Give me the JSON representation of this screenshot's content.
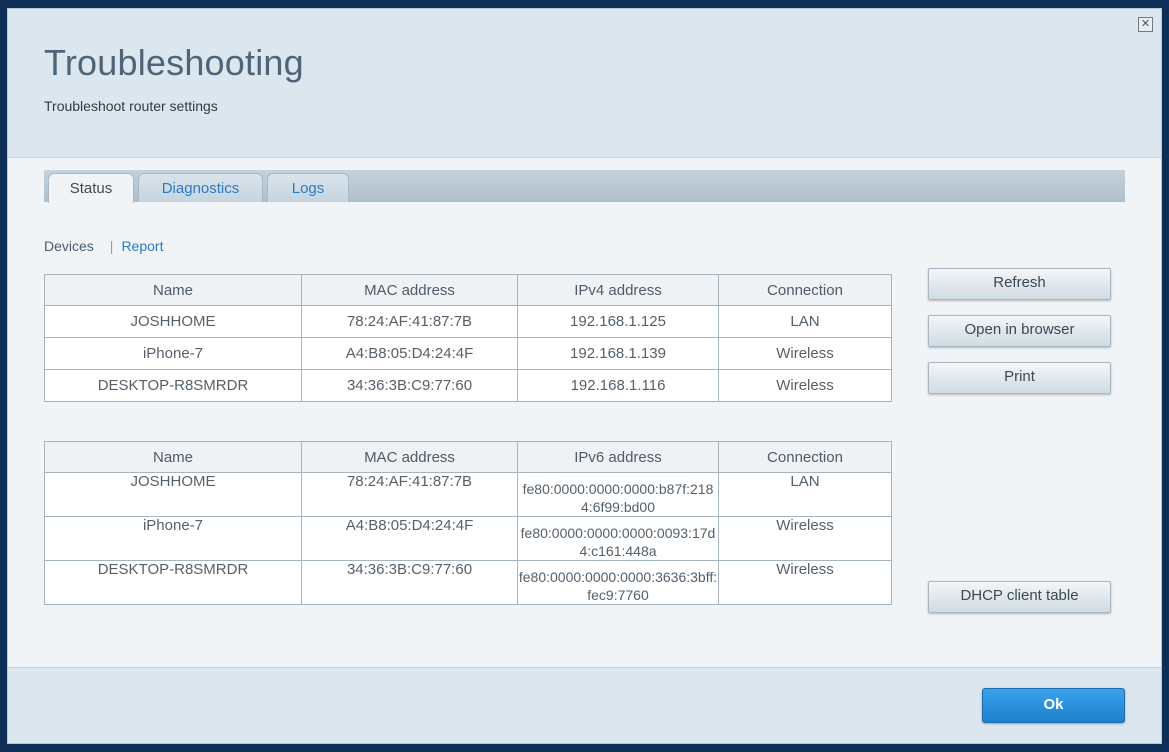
{
  "dialog": {
    "title": "Troubleshooting",
    "subtitle": "Troubleshoot router settings",
    "close_icon": "close-icon"
  },
  "tabs": [
    {
      "label": "Status",
      "active": true
    },
    {
      "label": "Diagnostics",
      "active": false
    },
    {
      "label": "Logs",
      "active": false
    }
  ],
  "subnav": {
    "devices": "Devices",
    "separator": "|",
    "report": "Report"
  },
  "ipv4_table": {
    "headers": [
      "Name",
      "MAC address",
      "IPv4 address",
      "Connection"
    ],
    "rows": [
      [
        "JOSHHOME",
        "78:24:AF:41:87:7B",
        "192.168.1.125",
        "LAN"
      ],
      [
        "iPhone-7",
        "A4:B8:05:D4:24:4F",
        "192.168.1.139",
        "Wireless"
      ],
      [
        "DESKTOP-R8SMRDR",
        "34:36:3B:C9:77:60",
        "192.168.1.116",
        "Wireless"
      ]
    ]
  },
  "ipv6_table": {
    "headers": [
      "Name",
      "MAC address",
      "IPv6 address",
      "Connection"
    ],
    "rows": [
      [
        "JOSHHOME",
        "78:24:AF:41:87:7B",
        "fe80:0000:0000:0000:b87f:2184:6f99:bd00",
        "LAN"
      ],
      [
        "iPhone-7",
        "A4:B8:05:D4:24:4F",
        "fe80:0000:0000:0000:0093:17d4:c161:448a",
        "Wireless"
      ],
      [
        "DESKTOP-R8SMRDR",
        "34:36:3B:C9:77:60",
        "fe80:0000:0000:0000:3636:3bff:fec9:7760",
        "Wireless"
      ]
    ]
  },
  "buttons": {
    "refresh": "Refresh",
    "open_in_browser": "Open in browser",
    "print": "Print",
    "dhcp_client_table": "DHCP client table",
    "ok": "Ok"
  },
  "colors": {
    "accent": "#2c7bc2",
    "ok_button": "#2a8ed9",
    "title": "#4e6478"
  }
}
